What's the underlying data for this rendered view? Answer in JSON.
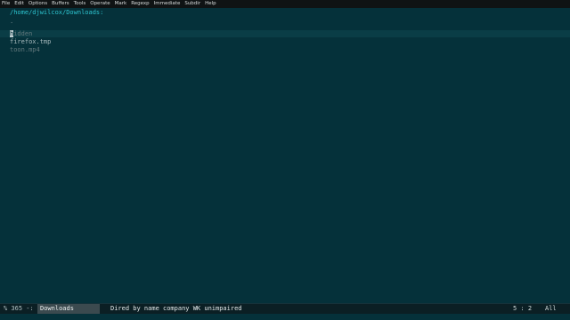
{
  "menubar": {
    "items": [
      "File",
      "Edit",
      "Options",
      "Buffers",
      "Tools",
      "Operate",
      "Mark",
      "Regexp",
      "Immediate",
      "Subdir",
      "Help"
    ]
  },
  "buffer": {
    "directory": "/home/djwilcox/Downloads:",
    "dot": ".",
    "entries": [
      {
        "name": "hidden",
        "cursor_char": "h",
        "rest": "idden"
      },
      {
        "name": "firefox.tmp"
      },
      {
        "name": "toon.mp4"
      }
    ]
  },
  "modeline": {
    "status": "% 365 -:",
    "buffer_name": "Downloads",
    "mode": "Dired by name company WK unimpaired",
    "position": "5 : 2",
    "scroll": "All"
  }
}
